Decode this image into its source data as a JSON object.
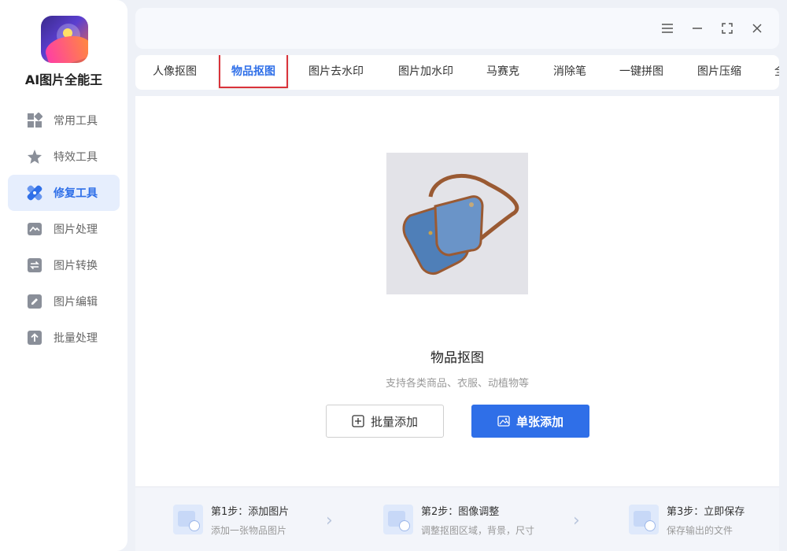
{
  "app": {
    "name": "AI图片全能王"
  },
  "sidebar": {
    "items": [
      {
        "label": "常用工具",
        "icon": "grid-icon",
        "active": false
      },
      {
        "label": "特效工具",
        "icon": "star-icon",
        "active": false
      },
      {
        "label": "修复工具",
        "icon": "bandage-icon",
        "active": true
      },
      {
        "label": "图片处理",
        "icon": "image-wave-icon",
        "active": false
      },
      {
        "label": "图片转换",
        "icon": "convert-icon",
        "active": false
      },
      {
        "label": "图片编辑",
        "icon": "edit-icon",
        "active": false
      },
      {
        "label": "批量处理",
        "icon": "upload-icon",
        "active": false
      }
    ]
  },
  "window_controls": [
    "menu-icon",
    "minimize-icon",
    "fullscreen-icon",
    "close-icon"
  ],
  "tabs": [
    {
      "label": "人像抠图"
    },
    {
      "label": "物品抠图",
      "active": true
    },
    {
      "label": "图片去水印"
    },
    {
      "label": "图片加水印"
    },
    {
      "label": "马赛克"
    },
    {
      "label": "消除笔"
    },
    {
      "label": "一键拼图"
    },
    {
      "label": "图片压缩"
    },
    {
      "label": "全"
    }
  ],
  "main": {
    "heading": "物品抠图",
    "subheading": "支持各类商品、衣服、动植物等",
    "batch_button": "批量添加",
    "single_button": "单张添加"
  },
  "steps": [
    {
      "title": "第1步：添加图片",
      "desc": "添加一张物品图片"
    },
    {
      "title": "第2步：图像调整",
      "desc": "调整抠图区域，背景，尺寸"
    },
    {
      "title": "第3步：立即保存",
      "desc": "保存输出的文件"
    }
  ],
  "colors": {
    "accent": "#2f6fe8",
    "active_tab_border": "#d9333a",
    "sidebar_active_bg": "#e6eefd"
  }
}
